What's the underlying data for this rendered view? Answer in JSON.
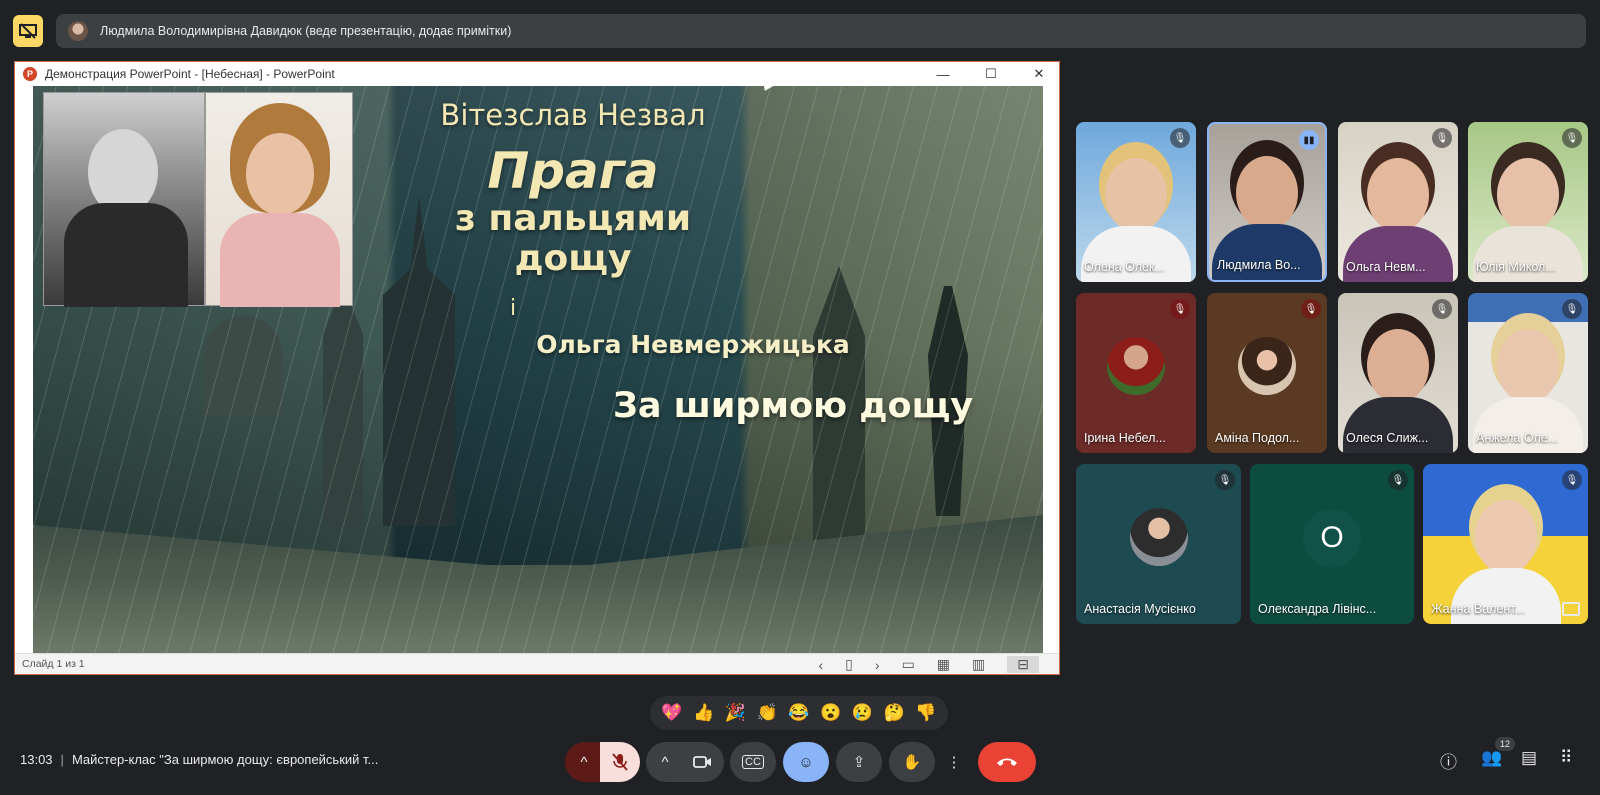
{
  "presenter": {
    "text": "Людмила Володимирівна Давидюк (веде презентацію, додає примітки)"
  },
  "ppt": {
    "window_title": "Демонстрация PowerPoint - [Небесная] - PowerPoint",
    "status": "Слайд 1 из 1",
    "slide": {
      "line1": "Вітезслав Незвал",
      "line2": "Прага",
      "line3": "з пальцями",
      "line4": "дощу",
      "line5": "і",
      "line6": "Ольга Невмержицька",
      "line7": "За ширмою дощу"
    }
  },
  "participants": [
    {
      "name": "Олена Олек..."
    },
    {
      "name": "Людмила Во..."
    },
    {
      "name": "Ольга Невм..."
    },
    {
      "name": "Юлія Микол..."
    },
    {
      "name": "Ірина Небел..."
    },
    {
      "name": "Аміна Подол..."
    },
    {
      "name": "Олеся Слиж..."
    },
    {
      "name": "Анжела Оле..."
    },
    {
      "name": "Анастасія Мусієнко"
    },
    {
      "name": "Олександра Лівінс...",
      "initial": "О"
    },
    {
      "name": "Жанна Валент..."
    }
  ],
  "reactions": [
    "💖",
    "👍",
    "🎉",
    "👏",
    "😂",
    "😮",
    "😢",
    "🤔",
    "👎"
  ],
  "meeting": {
    "time": "13:03",
    "title": "Майстер-клас \"За ширмою дощу: європейський т...",
    "participant_count": "12"
  },
  "colors": {
    "background": "#202124",
    "accent_blue": "#8ab4f8",
    "end_call_red": "#ea4335",
    "present_yellow": "#fdd663"
  }
}
